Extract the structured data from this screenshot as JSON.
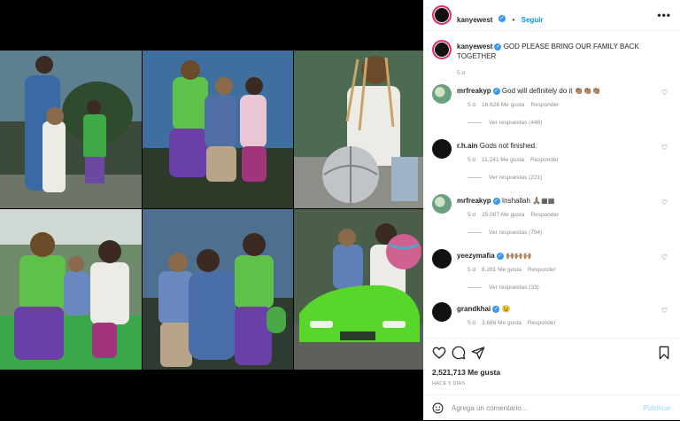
{
  "post": {
    "photos": [
      {
        "name": "photo-mother-children-garden"
      },
      {
        "name": "photo-kids-jumping"
      },
      {
        "name": "photo-girl-basketball"
      },
      {
        "name": "photo-kids-on-toy-car"
      },
      {
        "name": "photo-mother-son-kiss"
      },
      {
        "name": "photo-kids-in-green-lamborghini"
      }
    ]
  },
  "header": {
    "username": "kanyewest",
    "separator": "•",
    "follow_label": "Seguir",
    "more_icon": "more-horizontal-icon"
  },
  "caption": {
    "username": "kanyewest",
    "text": "GOD PLEASE BRING OUR FAMILY BACK TOGETHER",
    "time": "5 d"
  },
  "comments": [
    {
      "username": "mrfreakyp",
      "text": "God will definitely do it 👏🏽👏🏽👏🏽",
      "time": "5 d",
      "likes": "16,626 Me gusta",
      "reply": "Responder",
      "replies": "Ver respuestas (446)",
      "avatar": "#6aa080",
      "verified": true
    },
    {
      "username": "r.h.ain",
      "text": "Gods not finished.",
      "time": "5 d",
      "likes": "11,241 Me gusta",
      "reply": "Responder",
      "replies": "Ver respuestas (221)",
      "avatar": "#111111",
      "verified": false
    },
    {
      "username": "mrfreakyp",
      "text": "Inshallah 🙏🏽▦▦",
      "time": "5 d",
      "likes": "25,067 Me gusta",
      "reply": "Responder",
      "replies": "Ver respuestas (794)",
      "avatar": "#6aa080",
      "verified": true
    },
    {
      "username": "yeezymafia",
      "text": "🙌🏽🙌🏽🙌🏽",
      "time": "5 d",
      "likes": "8,281 Me gusta",
      "reply": "Responder",
      "replies": "Ver respuestas (33)",
      "avatar": "#111111",
      "verified": true
    },
    {
      "username": "grandkhai",
      "text": "😉",
      "time": "5 d",
      "likes": "3,686 Me gusta",
      "reply": "Responder",
      "replies": "",
      "avatar": "#111111",
      "verified": true
    }
  ],
  "actions": {
    "like_icon": "heart-icon",
    "comment_icon": "comment-icon",
    "share_icon": "paper-plane-icon",
    "save_icon": "bookmark-icon"
  },
  "likes": "2,521,713 Me gusta",
  "posted_ago": "HACE 5 DÍAS",
  "composer": {
    "placeholder": "Agrega un comentario...",
    "publish_label": "Publicar"
  },
  "colors": {
    "link_blue": "#0095f6",
    "verified_blue": "#3897f0",
    "publish_disabled": "#b2dffc"
  }
}
